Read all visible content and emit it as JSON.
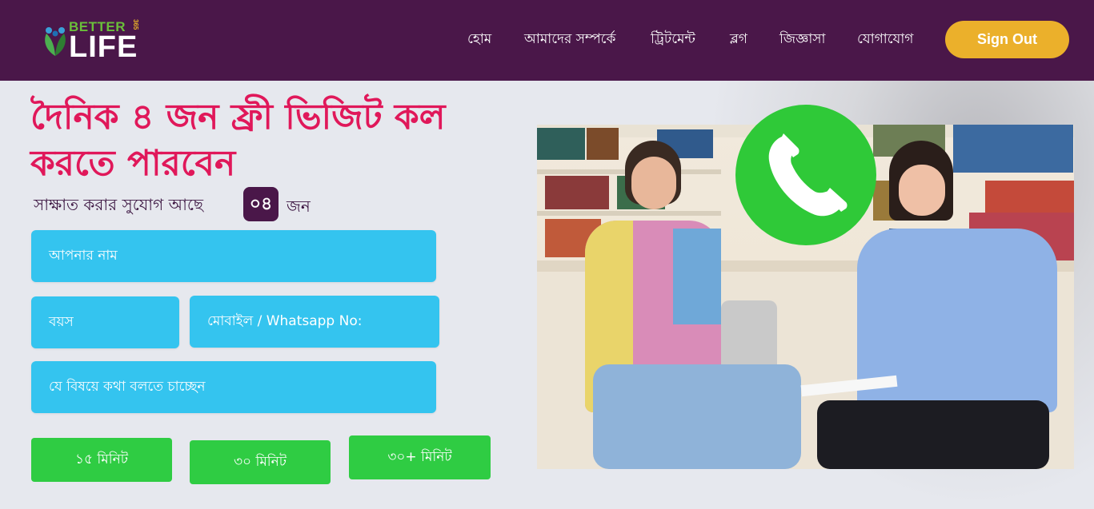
{
  "header": {
    "logo": {
      "better": "BETTER",
      "side": "365",
      "life": "LIFE"
    },
    "nav": [
      {
        "label": "হোম"
      },
      {
        "label": "আমাদের সম্পর্কে"
      },
      {
        "label": "ট্রিটমেন্ট"
      },
      {
        "label": "ব্লগ"
      },
      {
        "label": "জিজ্ঞাসা"
      },
      {
        "label": "যোগাযোগ"
      }
    ],
    "signout_label": "Sign Out"
  },
  "hero": {
    "heading_line1": "দৈনিক ৪ জন ফ্রী ভিজিট কল",
    "heading_line2": "করতে পারবেন",
    "availability_text": "সাক্ষাত করার সুযোগ আছে",
    "availability_count": "০৪",
    "availability_unit": "জন"
  },
  "form": {
    "name_placeholder": "আপনার নাম",
    "age_placeholder": "বয়স",
    "mobile_placeholder": "মোবাইল / Whatsapp No:",
    "topic_placeholder": "যে বিষয়ে কথা বলতে চাচ্ছেন",
    "durations": [
      "১৫ মিনিট",
      "৩০ মিনিট",
      "৩০+ মিনিট"
    ]
  },
  "icons": {
    "call": "phone-icon",
    "logo_mark": "people-leaf-icon"
  },
  "colors": {
    "header_bg": "#4a1749",
    "signout_bg": "#ebb02b",
    "heading": "#e0185a",
    "field_bg": "#34c4ef",
    "duration_bg": "#2fcc43",
    "call_badge": "#2fc938"
  }
}
